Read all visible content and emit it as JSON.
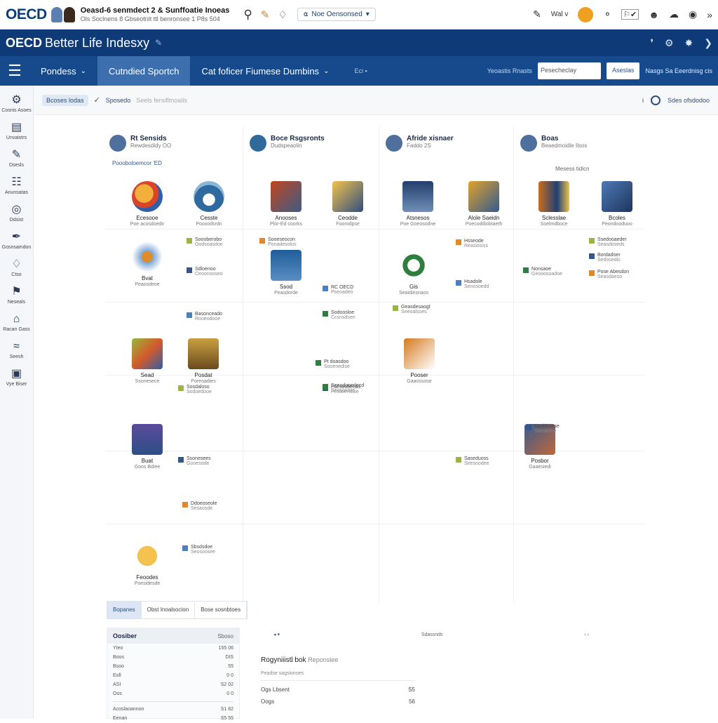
{
  "topbar": {
    "logo": "OECD",
    "title": "Oeasd-6 senmdect 2 & Sunffoatie Inoeas",
    "subtitle": "Ols Soclnens 8 Gbseotnlt ttl benronsee 1 P8s 504",
    "pill_label": "Noe Oensonsed",
    "flag": "Wal ᴠ"
  },
  "header": {
    "brand_bold": "OECD",
    "brand_rest": "Better Life Indesxy"
  },
  "navbar": {
    "items": [
      {
        "label": "Pondess"
      },
      {
        "label": "Cutndied Sportch"
      },
      {
        "label": "Cat foficer Fiumese Dumbins"
      }
    ],
    "muted": "Eci ▪",
    "search_label": "Yeoastis Rnasts",
    "input_value": "Pesecheclay",
    "button": "Aseslas",
    "help": "Nasgs Sa Eeerdnisg cis"
  },
  "sidebar": {
    "items": [
      {
        "icon": "⚙",
        "label": "Cosnis Asoes"
      },
      {
        "icon": "▤",
        "label": "Unvaistrs"
      },
      {
        "icon": "✎",
        "label": "Dsesls"
      },
      {
        "icon": "☷",
        "label": "Anunsatas"
      },
      {
        "icon": "◎",
        "label": "Ddsist"
      },
      {
        "icon": "✒",
        "label": "Gosnsamdon"
      },
      {
        "icon": "♢",
        "label": "Ctso"
      },
      {
        "icon": "⚑",
        "label": "Neseals"
      },
      {
        "icon": "⌂",
        "label": "Racan Gass"
      },
      {
        "icon": "≈",
        "label": "Seesh"
      },
      {
        "icon": "▣",
        "label": "Vye Biser"
      }
    ]
  },
  "crumbs": {
    "chip": "Bcoses lodas",
    "text": "Sposedo",
    "muted": "Seels fersifltnoalis",
    "right_info": "i",
    "right_label": "Sdes ofsdodoo"
  },
  "columns": [
    {
      "title": "Rt Sensids",
      "sub": "Rewdesdidy OO",
      "note": "Poooboloemcor 'ED"
    },
    {
      "title": "Boce Rsgsronts",
      "sub": "Dudspeaolin"
    },
    {
      "title": "Afride xisnaer",
      "sub": "Faddo 2S"
    },
    {
      "title": "Boas",
      "sub": "Beaedmoidle Ilsos",
      "note": "Mesess tidicn"
    }
  ],
  "tiles": [
    {
      "t1": "Ecesooe",
      "t2": "Poe acosdoedir"
    },
    {
      "t1": "Cesste",
      "t2": "Pooxodsrdn"
    },
    {
      "t1": "Anooses",
      "t2": "Plor-Ed coorks"
    },
    {
      "t1": "Ceodde",
      "t2": "Foorodpse"
    },
    {
      "t1": "Atsnesos",
      "t2": "Poe Goeosodne"
    },
    {
      "t1": "Alole Saeidn",
      "t2": "Poecoddiobtaeth"
    },
    {
      "t1": "Sclesslae",
      "t2": "Soelmdboce"
    },
    {
      "t1": "Bcoles",
      "t2": "Peondooduoo"
    },
    {
      "t1": "Bvat",
      "t2": "Peaosdeoe"
    },
    {
      "t1": "Ssod",
      "t2": "Peasdorde"
    },
    {
      "t1": "Gis",
      "t2": "Seaidiesnaos"
    },
    {
      "t1": "Sead",
      "t2": "Ssonesece"
    },
    {
      "t1": "Posdat",
      "t2": "Poreoadies"
    },
    {
      "t1": "Pooser",
      "t2": "Gaaossose"
    },
    {
      "t1": "Buat",
      "t2": "Goos Bdiee"
    },
    {
      "t1": "Posbor",
      "t2": "Gaaesiedi"
    },
    {
      "t1": "Feoodes",
      "t2": "Poesidesde"
    }
  ],
  "items": [
    {
      "l1": "Soooberobo",
      "l2": "Oodsoasdoe"
    },
    {
      "l1": "Sdloenoo",
      "l2": "Ceoonooseo"
    },
    {
      "l1": "Sooeseocon",
      "l2": "Ponadesolos"
    },
    {
      "l1": "Basonceado",
      "l2": "Rooeodooe"
    },
    {
      "l1": "Sodoosloe",
      "l2": "Ccsnsdsen"
    },
    {
      "l1": "Sosdaloso",
      "l2": "Sodoedooe"
    },
    {
      "l1": "Ssonesees",
      "l2": "Gooesode"
    },
    {
      "l1": "Ddoeoseole",
      "l2": "Sesaosde"
    },
    {
      "l1": "RC OECD",
      "l2": "Pseoadeo"
    },
    {
      "l1": "Pt doasdoo",
      "l2": "Sooenedise"
    },
    {
      "l1": "Geasdesaogt",
      "l2": "Seeoalsoes"
    },
    {
      "l1": "Faesoobecas",
      "l2": "Fessoendsie"
    },
    {
      "l1": "Hsseode",
      "l2": "Reasiosiss"
    },
    {
      "l1": "Hsadole",
      "l2": "Senosoedd"
    },
    {
      "l1": "Nonsaoe",
      "l2": "Geooosoadoe"
    },
    {
      "l1": "Ssedooaeder",
      "l2": "Seasdoseds"
    },
    {
      "l1": "Bordadoer",
      "l2": "Sedosedis"
    },
    {
      "l1": "Pose Abesdon",
      "l2": "Seasdaeso"
    },
    {
      "l1": "Sbsdsdoe",
      "l2": "Seosoosee"
    },
    {
      "l1": "Seeodooedecd",
      "l2": "Seosososs"
    },
    {
      "l1": "Saseduoss",
      "l2": "Seesoodee"
    },
    {
      "l1": "Ooddsoose",
      "l2": "Sooseose"
    }
  ],
  "tabs": [
    "Bopanes",
    "Obst Inoalsocion",
    "Bose sosnbtoes"
  ],
  "table": {
    "title": "Oosiber",
    "title_right": "Sboso",
    "rows": [
      {
        "a": "Yteo",
        "b": "155 06"
      },
      {
        "a": "Boos",
        "b": "DIS"
      },
      {
        "a": "Bsoo",
        "b": "55"
      },
      {
        "a": "Eoll",
        "b": "0 0"
      },
      {
        "a": "ASI",
        "b": "S2 02"
      },
      {
        "a": "Oos",
        "b": "0 0"
      }
    ],
    "footer": [
      {
        "a": "Acoslaoannon",
        "b": "S1 82"
      },
      {
        "a": "Eenan",
        "b": "S5 55"
      }
    ]
  },
  "detail_strip": {
    "left": "◂ ▾",
    "center": "Sdassnds",
    "right": "‹ ›"
  },
  "detail": {
    "title": "Rogyniiistl bok",
    "title_tail": "Reponslee",
    "meta": "Peadse sagsionoes",
    "rows": [
      {
        "a": "Ogs Lbsent",
        "b": "S5"
      },
      {
        "a": "Oogs",
        "b": "56"
      }
    ]
  }
}
